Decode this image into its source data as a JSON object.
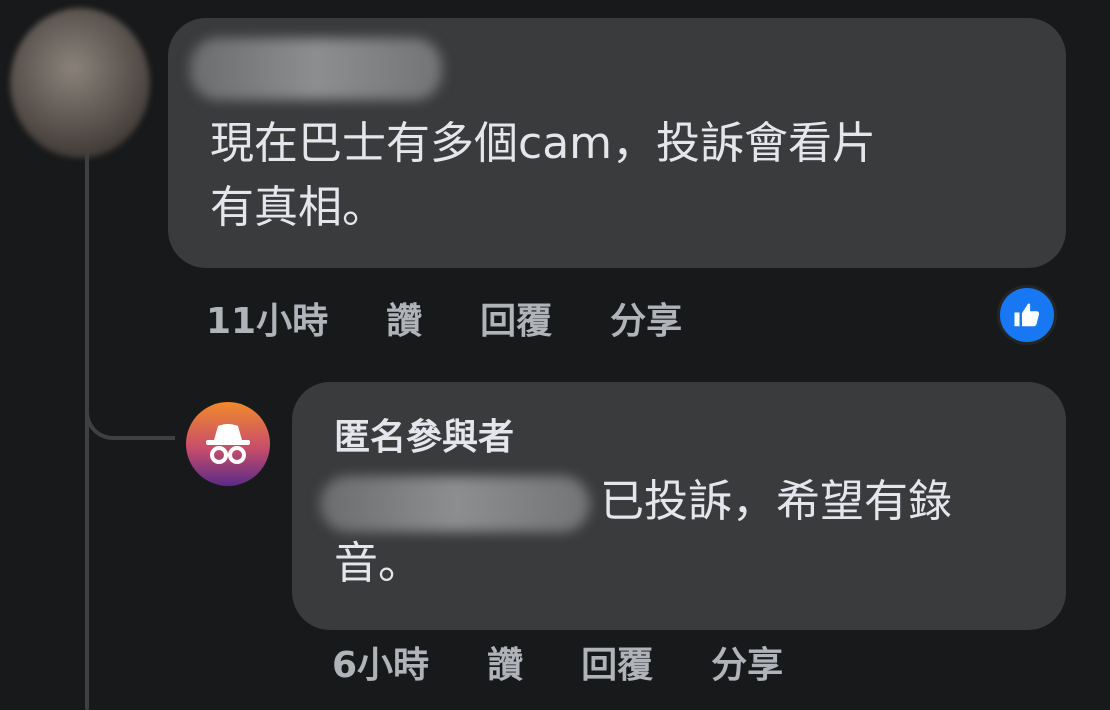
{
  "comment": {
    "text_line1": "現在巴士有多個cam，投訴會看片",
    "text_line2": "有真相。",
    "time": "11小時",
    "like_label": "讚",
    "reply_label": "回覆",
    "share_label": "分享",
    "reaction_icon": "thumbs-up-icon",
    "reaction_color": "#1877f2"
  },
  "reply": {
    "author": "匿名參與者",
    "text_line1": "已投訴，希望有錄",
    "text_line2": "音。",
    "time": "6小時",
    "like_label": "讚",
    "reply_label": "回覆",
    "share_label": "分享",
    "avatar_icon": "incognito-icon"
  },
  "theme": {
    "background": "#18191a",
    "bubble": "#3a3b3c",
    "text": "#e4e6eb",
    "muted": "#b0b3b8"
  }
}
